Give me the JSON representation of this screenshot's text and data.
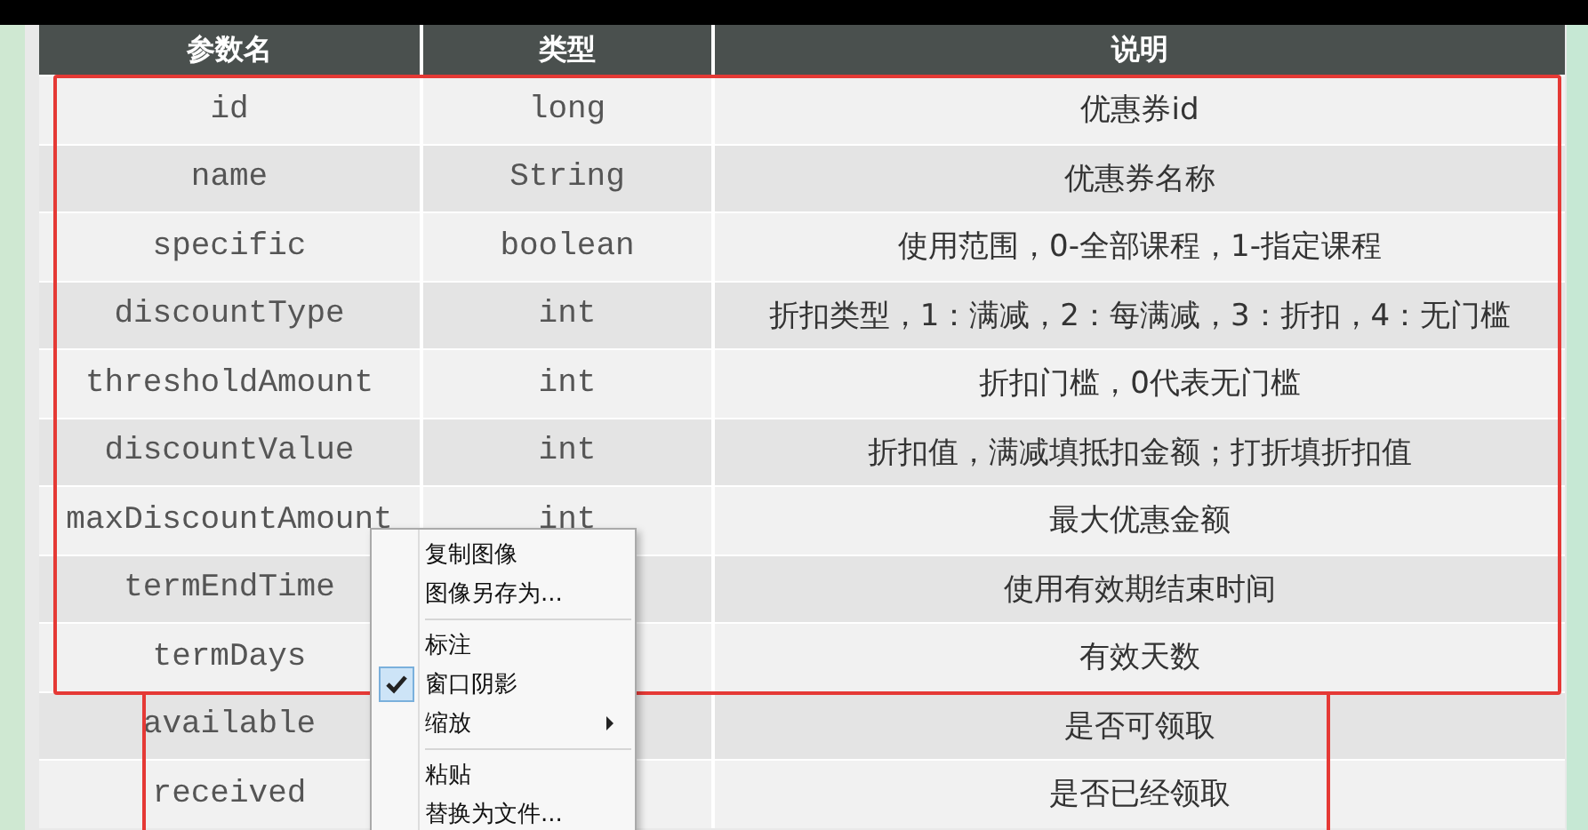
{
  "table": {
    "columns": [
      "参数名",
      "类型",
      "说明"
    ],
    "rows": [
      {
        "name": "id",
        "type": "long",
        "description": "优惠券id",
        "kind": "full"
      },
      {
        "name": "name",
        "type": "String",
        "description": "优惠券名称",
        "kind": "full"
      },
      {
        "name": "specific",
        "type": "boolean",
        "description": "使用范围，0-全部课程，1-指定课程",
        "kind": "full"
      },
      {
        "name": "discountType",
        "type": "int",
        "description": "折扣类型，1：满减，2：每满减，3：折扣，4：无门槛",
        "kind": "full"
      },
      {
        "name": "thresholdAmount",
        "type": "int",
        "description": "折扣门槛，0代表无门槛",
        "kind": "full"
      },
      {
        "name": "discountValue",
        "type": "int",
        "description": "折扣值，满减填抵扣金额；打折填折扣值",
        "kind": "full"
      },
      {
        "name": "maxDiscountAmount",
        "type": "int",
        "description": "最大优惠金额",
        "kind": "full"
      },
      {
        "name": "termEndTime",
        "description": "使用有效期结束时间",
        "kind": "full"
      },
      {
        "name": "termDays",
        "description": "有效天数",
        "kind": "full"
      },
      {
        "name": "available",
        "description": "是否可领取",
        "kind": "partial"
      },
      {
        "name": "received",
        "description": "是否已经领取",
        "kind": "partial"
      }
    ]
  },
  "context_menu": {
    "items": [
      {
        "kind": "item",
        "label": "复制图像",
        "checked": false,
        "submenu": false
      },
      {
        "kind": "item",
        "label": "图像另存为...",
        "checked": false,
        "submenu": false
      },
      {
        "kind": "separator"
      },
      {
        "kind": "item",
        "label": "标注",
        "checked": false,
        "submenu": false
      },
      {
        "kind": "item",
        "label": "窗口阴影",
        "checked": true,
        "submenu": false
      },
      {
        "kind": "item",
        "label": "缩放",
        "checked": false,
        "submenu": true
      },
      {
        "kind": "separator"
      },
      {
        "kind": "item",
        "label": "粘贴",
        "checked": false,
        "submenu": false
      },
      {
        "kind": "item",
        "label": "替换为文件...",
        "checked": false,
        "submenu": false
      }
    ]
  }
}
